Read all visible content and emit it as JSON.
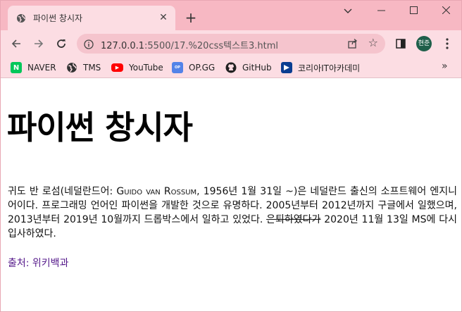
{
  "browser": {
    "tab": {
      "title": "파이썬 창시자",
      "close_glyph": "✕",
      "favicon": "globe-icon"
    },
    "new_tab_glyph": "+",
    "window_controls": {
      "dropdown": "⌄",
      "minimize": "—",
      "maximize": "☐",
      "close": "✕"
    },
    "toolbar": {
      "url_host": "127.0.0.1",
      "url_rest": ":5500/17.%20css텍스트3.html",
      "profile_label": "현준"
    },
    "bookmarks": [
      {
        "label": "NAVER",
        "icon": "naver-icon",
        "color": "#03c75a",
        "glyph": "N"
      },
      {
        "label": "TMS",
        "icon": "globe-icon",
        "color": "#333333",
        "glyph": ""
      },
      {
        "label": "YouTube",
        "icon": "youtube-icon",
        "color": "#ff0000",
        "glyph": "▶"
      },
      {
        "label": "OP.GG",
        "icon": "opgg-icon",
        "color": "#5383e8",
        "glyph": ""
      },
      {
        "label": "GitHub",
        "icon": "github-icon",
        "color": "#222222",
        "glyph": ""
      },
      {
        "label": "코리아IT아카데미",
        "icon": "koreait-icon",
        "color": "#0b3d91",
        "glyph": ""
      }
    ],
    "bookmarks_more": "»"
  },
  "page": {
    "heading": "파이썬 창시자",
    "para_1": "귀도 반 로섬(네덜란드어: ",
    "para_name": "Guido van Rossum",
    "para_2": ", 1956년 1월 31일 ~)은 네덜란드 출신의 소프트웨어 엔지니어이다. 프로그래밍 언어인 파이썬을 개발한 것으로 유명하다. 2005년부터 2012년까지 구글에서 일했으며, 2013년부터 2019년 10월까지 드롭박스에서 일하고 있었다. ",
    "para_strike": "은퇴하였다가",
    "para_3": " 2020년 11월 13일 MS에 다시 입사하였다.",
    "source_link": "출처: 위키백과"
  }
}
